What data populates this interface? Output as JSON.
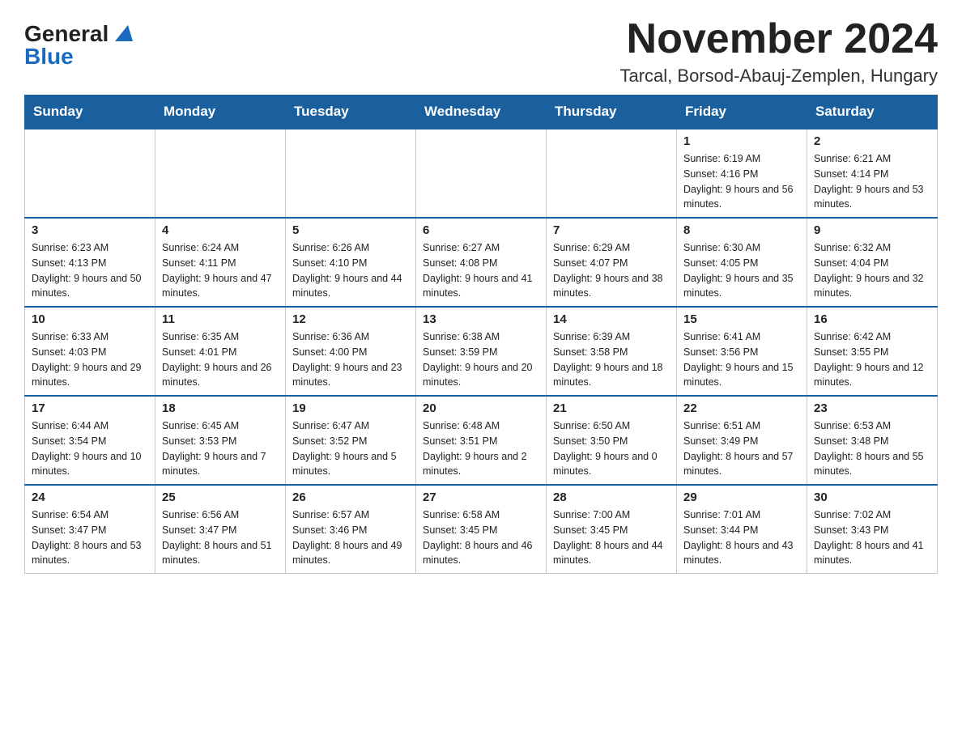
{
  "logo": {
    "general": "General",
    "blue": "Blue"
  },
  "title": {
    "month_year": "November 2024",
    "location": "Tarcal, Borsod-Abauj-Zemplen, Hungary"
  },
  "headers": [
    "Sunday",
    "Monday",
    "Tuesday",
    "Wednesday",
    "Thursday",
    "Friday",
    "Saturday"
  ],
  "weeks": [
    [
      {
        "day": "",
        "sunrise": "",
        "sunset": "",
        "daylight": ""
      },
      {
        "day": "",
        "sunrise": "",
        "sunset": "",
        "daylight": ""
      },
      {
        "day": "",
        "sunrise": "",
        "sunset": "",
        "daylight": ""
      },
      {
        "day": "",
        "sunrise": "",
        "sunset": "",
        "daylight": ""
      },
      {
        "day": "",
        "sunrise": "",
        "sunset": "",
        "daylight": ""
      },
      {
        "day": "1",
        "sunrise": "Sunrise: 6:19 AM",
        "sunset": "Sunset: 4:16 PM",
        "daylight": "Daylight: 9 hours and 56 minutes."
      },
      {
        "day": "2",
        "sunrise": "Sunrise: 6:21 AM",
        "sunset": "Sunset: 4:14 PM",
        "daylight": "Daylight: 9 hours and 53 minutes."
      }
    ],
    [
      {
        "day": "3",
        "sunrise": "Sunrise: 6:23 AM",
        "sunset": "Sunset: 4:13 PM",
        "daylight": "Daylight: 9 hours and 50 minutes."
      },
      {
        "day": "4",
        "sunrise": "Sunrise: 6:24 AM",
        "sunset": "Sunset: 4:11 PM",
        "daylight": "Daylight: 9 hours and 47 minutes."
      },
      {
        "day": "5",
        "sunrise": "Sunrise: 6:26 AM",
        "sunset": "Sunset: 4:10 PM",
        "daylight": "Daylight: 9 hours and 44 minutes."
      },
      {
        "day": "6",
        "sunrise": "Sunrise: 6:27 AM",
        "sunset": "Sunset: 4:08 PM",
        "daylight": "Daylight: 9 hours and 41 minutes."
      },
      {
        "day": "7",
        "sunrise": "Sunrise: 6:29 AM",
        "sunset": "Sunset: 4:07 PM",
        "daylight": "Daylight: 9 hours and 38 minutes."
      },
      {
        "day": "8",
        "sunrise": "Sunrise: 6:30 AM",
        "sunset": "Sunset: 4:05 PM",
        "daylight": "Daylight: 9 hours and 35 minutes."
      },
      {
        "day": "9",
        "sunrise": "Sunrise: 6:32 AM",
        "sunset": "Sunset: 4:04 PM",
        "daylight": "Daylight: 9 hours and 32 minutes."
      }
    ],
    [
      {
        "day": "10",
        "sunrise": "Sunrise: 6:33 AM",
        "sunset": "Sunset: 4:03 PM",
        "daylight": "Daylight: 9 hours and 29 minutes."
      },
      {
        "day": "11",
        "sunrise": "Sunrise: 6:35 AM",
        "sunset": "Sunset: 4:01 PM",
        "daylight": "Daylight: 9 hours and 26 minutes."
      },
      {
        "day": "12",
        "sunrise": "Sunrise: 6:36 AM",
        "sunset": "Sunset: 4:00 PM",
        "daylight": "Daylight: 9 hours and 23 minutes."
      },
      {
        "day": "13",
        "sunrise": "Sunrise: 6:38 AM",
        "sunset": "Sunset: 3:59 PM",
        "daylight": "Daylight: 9 hours and 20 minutes."
      },
      {
        "day": "14",
        "sunrise": "Sunrise: 6:39 AM",
        "sunset": "Sunset: 3:58 PM",
        "daylight": "Daylight: 9 hours and 18 minutes."
      },
      {
        "day": "15",
        "sunrise": "Sunrise: 6:41 AM",
        "sunset": "Sunset: 3:56 PM",
        "daylight": "Daylight: 9 hours and 15 minutes."
      },
      {
        "day": "16",
        "sunrise": "Sunrise: 6:42 AM",
        "sunset": "Sunset: 3:55 PM",
        "daylight": "Daylight: 9 hours and 12 minutes."
      }
    ],
    [
      {
        "day": "17",
        "sunrise": "Sunrise: 6:44 AM",
        "sunset": "Sunset: 3:54 PM",
        "daylight": "Daylight: 9 hours and 10 minutes."
      },
      {
        "day": "18",
        "sunrise": "Sunrise: 6:45 AM",
        "sunset": "Sunset: 3:53 PM",
        "daylight": "Daylight: 9 hours and 7 minutes."
      },
      {
        "day": "19",
        "sunrise": "Sunrise: 6:47 AM",
        "sunset": "Sunset: 3:52 PM",
        "daylight": "Daylight: 9 hours and 5 minutes."
      },
      {
        "day": "20",
        "sunrise": "Sunrise: 6:48 AM",
        "sunset": "Sunset: 3:51 PM",
        "daylight": "Daylight: 9 hours and 2 minutes."
      },
      {
        "day": "21",
        "sunrise": "Sunrise: 6:50 AM",
        "sunset": "Sunset: 3:50 PM",
        "daylight": "Daylight: 9 hours and 0 minutes."
      },
      {
        "day": "22",
        "sunrise": "Sunrise: 6:51 AM",
        "sunset": "Sunset: 3:49 PM",
        "daylight": "Daylight: 8 hours and 57 minutes."
      },
      {
        "day": "23",
        "sunrise": "Sunrise: 6:53 AM",
        "sunset": "Sunset: 3:48 PM",
        "daylight": "Daylight: 8 hours and 55 minutes."
      }
    ],
    [
      {
        "day": "24",
        "sunrise": "Sunrise: 6:54 AM",
        "sunset": "Sunset: 3:47 PM",
        "daylight": "Daylight: 8 hours and 53 minutes."
      },
      {
        "day": "25",
        "sunrise": "Sunrise: 6:56 AM",
        "sunset": "Sunset: 3:47 PM",
        "daylight": "Daylight: 8 hours and 51 minutes."
      },
      {
        "day": "26",
        "sunrise": "Sunrise: 6:57 AM",
        "sunset": "Sunset: 3:46 PM",
        "daylight": "Daylight: 8 hours and 49 minutes."
      },
      {
        "day": "27",
        "sunrise": "Sunrise: 6:58 AM",
        "sunset": "Sunset: 3:45 PM",
        "daylight": "Daylight: 8 hours and 46 minutes."
      },
      {
        "day": "28",
        "sunrise": "Sunrise: 7:00 AM",
        "sunset": "Sunset: 3:45 PM",
        "daylight": "Daylight: 8 hours and 44 minutes."
      },
      {
        "day": "29",
        "sunrise": "Sunrise: 7:01 AM",
        "sunset": "Sunset: 3:44 PM",
        "daylight": "Daylight: 8 hours and 43 minutes."
      },
      {
        "day": "30",
        "sunrise": "Sunrise: 7:02 AM",
        "sunset": "Sunset: 3:43 PM",
        "daylight": "Daylight: 8 hours and 41 minutes."
      }
    ]
  ]
}
